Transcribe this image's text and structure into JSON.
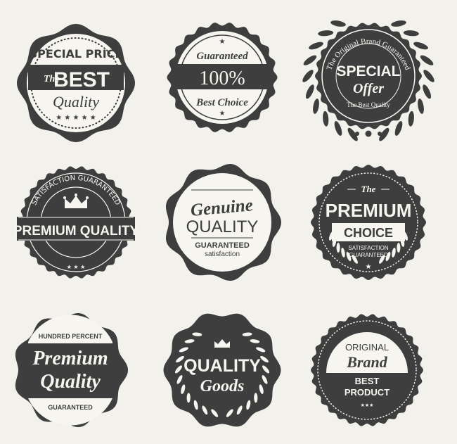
{
  "colors": {
    "badge_dark": "#3e3e3e",
    "badge_light": "#f7f5f0",
    "background": "#f3f1ec"
  },
  "badges": [
    {
      "id": "b1",
      "lines": [
        "SPECIAL PRICE",
        "The",
        "BEST",
        "Quality"
      ]
    },
    {
      "id": "b2",
      "lines": [
        "Guaranteed",
        "100%",
        "Best Choice"
      ]
    },
    {
      "id": "b3",
      "lines": [
        "The Original Brand Guaranteed",
        "SPECIAL",
        "Offer",
        "The Best Quality"
      ]
    },
    {
      "id": "b4",
      "lines": [
        "SATISFACTION GUARANTEED",
        "PREMIUM QUALITY"
      ]
    },
    {
      "id": "b5",
      "lines": [
        "Genuine",
        "QUALITY",
        "GUARANTEED",
        "satisfaction"
      ]
    },
    {
      "id": "b6",
      "lines": [
        "The",
        "PREMIUM",
        "CHOICE",
        "SATISFACTION",
        "GUARANTEED"
      ]
    },
    {
      "id": "b7",
      "lines": [
        "HUNDRED PERCENT",
        "Premium",
        "Quality",
        "GUARANTEED"
      ]
    },
    {
      "id": "b8",
      "lines": [
        "QUALITY",
        "Goods"
      ]
    },
    {
      "id": "b9",
      "lines": [
        "ORIGINAL",
        "Brand",
        "BEST",
        "PRODUCT"
      ]
    }
  ]
}
